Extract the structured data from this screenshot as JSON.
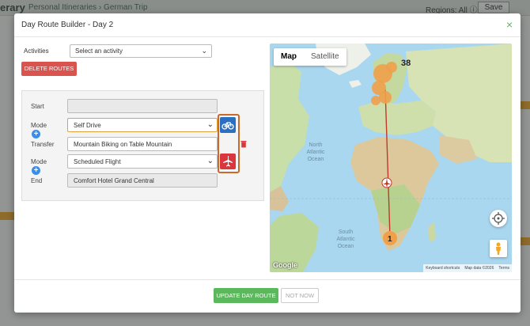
{
  "background": {
    "brand": "erary",
    "breadcrumb": "Personal Itineraries  ›  German Trip",
    "regions": "Regions: All ⓘ",
    "save": "Save"
  },
  "modal": {
    "title": "Day Route Builder - Day 2",
    "close": "×",
    "activities_label": "Activities",
    "activities_placeholder": "Select an activity",
    "delete_routes": "DELETE ROUTES",
    "route": {
      "start_label": "Start",
      "start_value": "",
      "mode1_label": "Mode",
      "mode1_value": "Self Drive",
      "transfer_label": "Transfer",
      "transfer_value": "Mountain Biking on Table Mountain",
      "mode2_label": "Mode",
      "mode2_value": "Scheduled Flight",
      "end_label": "End",
      "end_value": "Comfort Hotel Grand Central"
    },
    "update_button": "UPDATE DAY ROUTE",
    "not_now_button": "NOT NOW"
  },
  "map": {
    "tab_map": "Map",
    "tab_satellite": "Satellite",
    "cluster_north": "38",
    "cluster_south": "1",
    "labels": {
      "atlantic_n1": "North",
      "atlantic_n2": "Atlantic",
      "atlantic_n3": "Ocean",
      "atlantic_s1": "South",
      "atlantic_s2": "Atlantic",
      "atlantic_s3": "Ocean"
    },
    "google": "Google",
    "footer_shortcuts": "Keyboard shortcuts",
    "footer_data": "Map data ©2026",
    "footer_terms": "Terms"
  },
  "colors": {
    "accent_green": "#5cb85c",
    "danger_red": "#d9534f",
    "bike_blue": "#2a6fc0",
    "plane_red": "#d9363e",
    "highlight_orange": "#c96a2a"
  }
}
